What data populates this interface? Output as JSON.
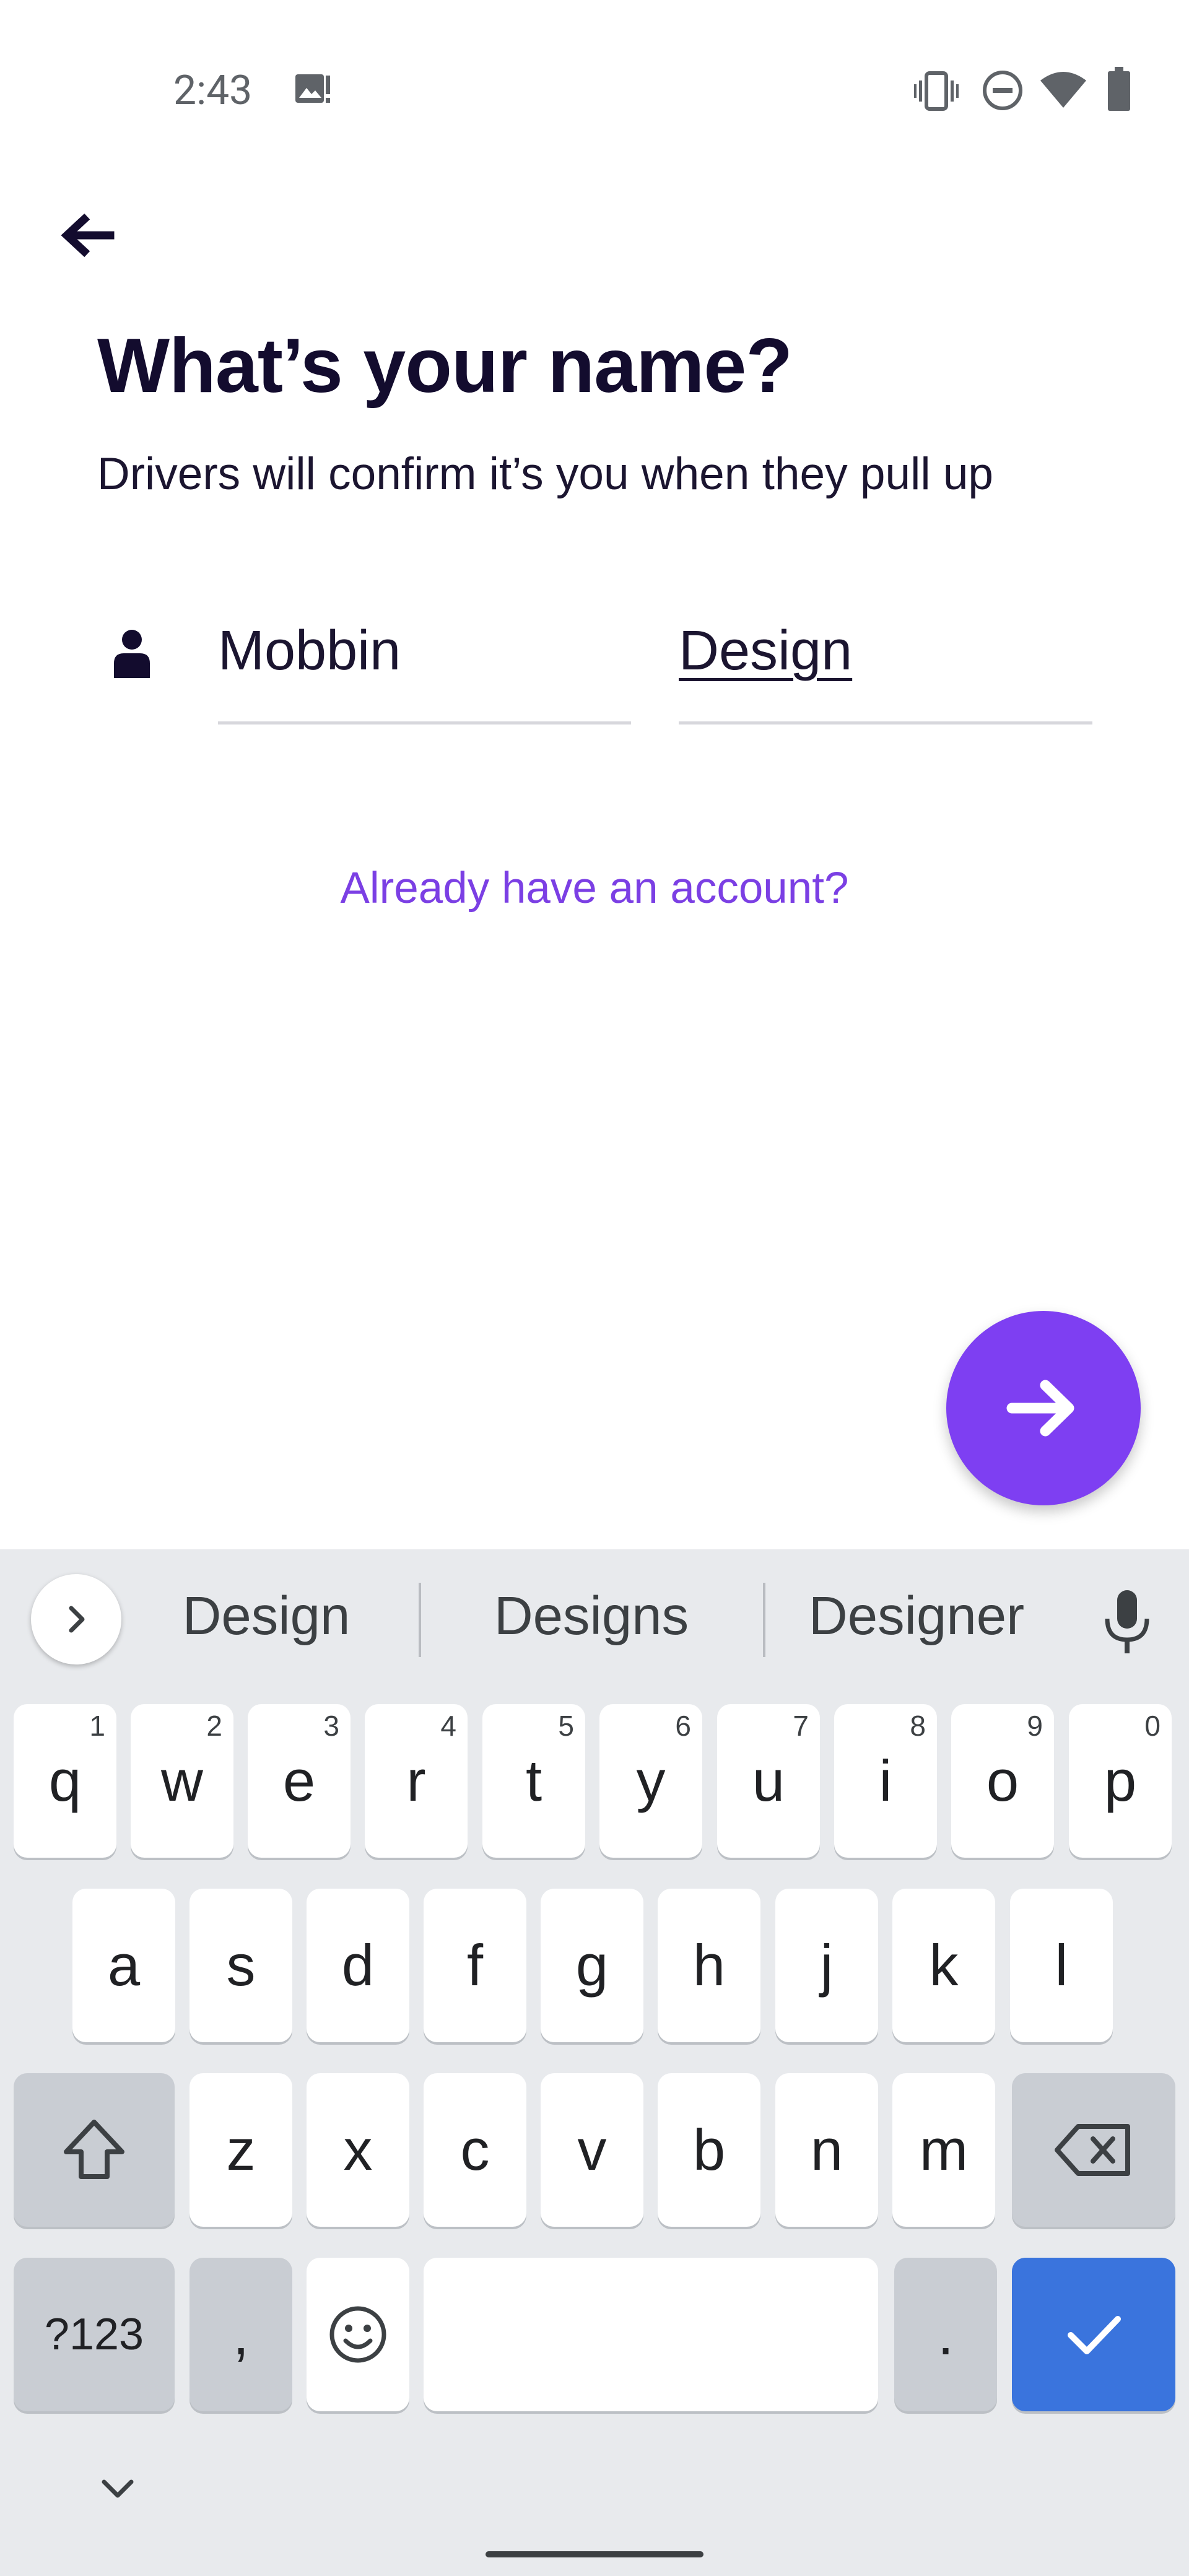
{
  "status_bar": {
    "time": "2:43",
    "icons": [
      "gallery-alert-icon",
      "vibrate-icon",
      "do-not-disturb-icon",
      "wifi-icon",
      "battery-icon"
    ]
  },
  "header": {
    "back_icon": "arrow-left-icon",
    "title": "What’s your name?",
    "subtitle": "Drivers will confirm it’s you when they pull up"
  },
  "form": {
    "person_icon": "person-icon",
    "first_name": "Mobbin",
    "last_name": "Design",
    "account_link": "Already have an account?"
  },
  "fab": {
    "icon": "arrow-right-icon",
    "color": "#7e3ff2"
  },
  "keyboard": {
    "suggestions": [
      "Design",
      "Designs",
      "Designer"
    ],
    "row1": [
      {
        "k": "q",
        "h": "1"
      },
      {
        "k": "w",
        "h": "2"
      },
      {
        "k": "e",
        "h": "3"
      },
      {
        "k": "r",
        "h": "4"
      },
      {
        "k": "t",
        "h": "5"
      },
      {
        "k": "y",
        "h": "6"
      },
      {
        "k": "u",
        "h": "7"
      },
      {
        "k": "i",
        "h": "8"
      },
      {
        "k": "o",
        "h": "9"
      },
      {
        "k": "p",
        "h": "0"
      }
    ],
    "row2": [
      "a",
      "s",
      "d",
      "f",
      "g",
      "h",
      "j",
      "k",
      "l"
    ],
    "row3": [
      "z",
      "x",
      "c",
      "v",
      "b",
      "n",
      "m"
    ],
    "symbols_label": "?123",
    "comma": ",",
    "period": ".",
    "action_color": "#3a74dd"
  }
}
